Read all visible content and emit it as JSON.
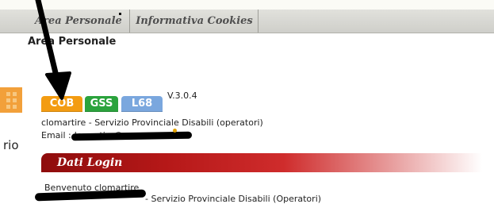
{
  "tabs": [
    {
      "label": "Area Personale"
    },
    {
      "label": "Informativa Cookies"
    }
  ],
  "page_title": "Area Personale",
  "side_text": "rio",
  "badges": {
    "cob": "COB",
    "gss": "GSS",
    "l68": "L68"
  },
  "version": "V.3.0.4",
  "user_info": "clomartire - Servizio Provinciale Disabili (operatori)",
  "email_label": "Email :",
  "email_value": "lomartire@g",
  "login_section": {
    "title": "Dati Login",
    "welcome": "Benvenuto clomartire",
    "welcome_sub": "- Servizio Provinciale Disabili (Operatori)"
  },
  "colors": {
    "cob": "#f39c12",
    "gss": "#2ba33d",
    "l68": "#7aa7de",
    "login_header": "#b51818"
  }
}
